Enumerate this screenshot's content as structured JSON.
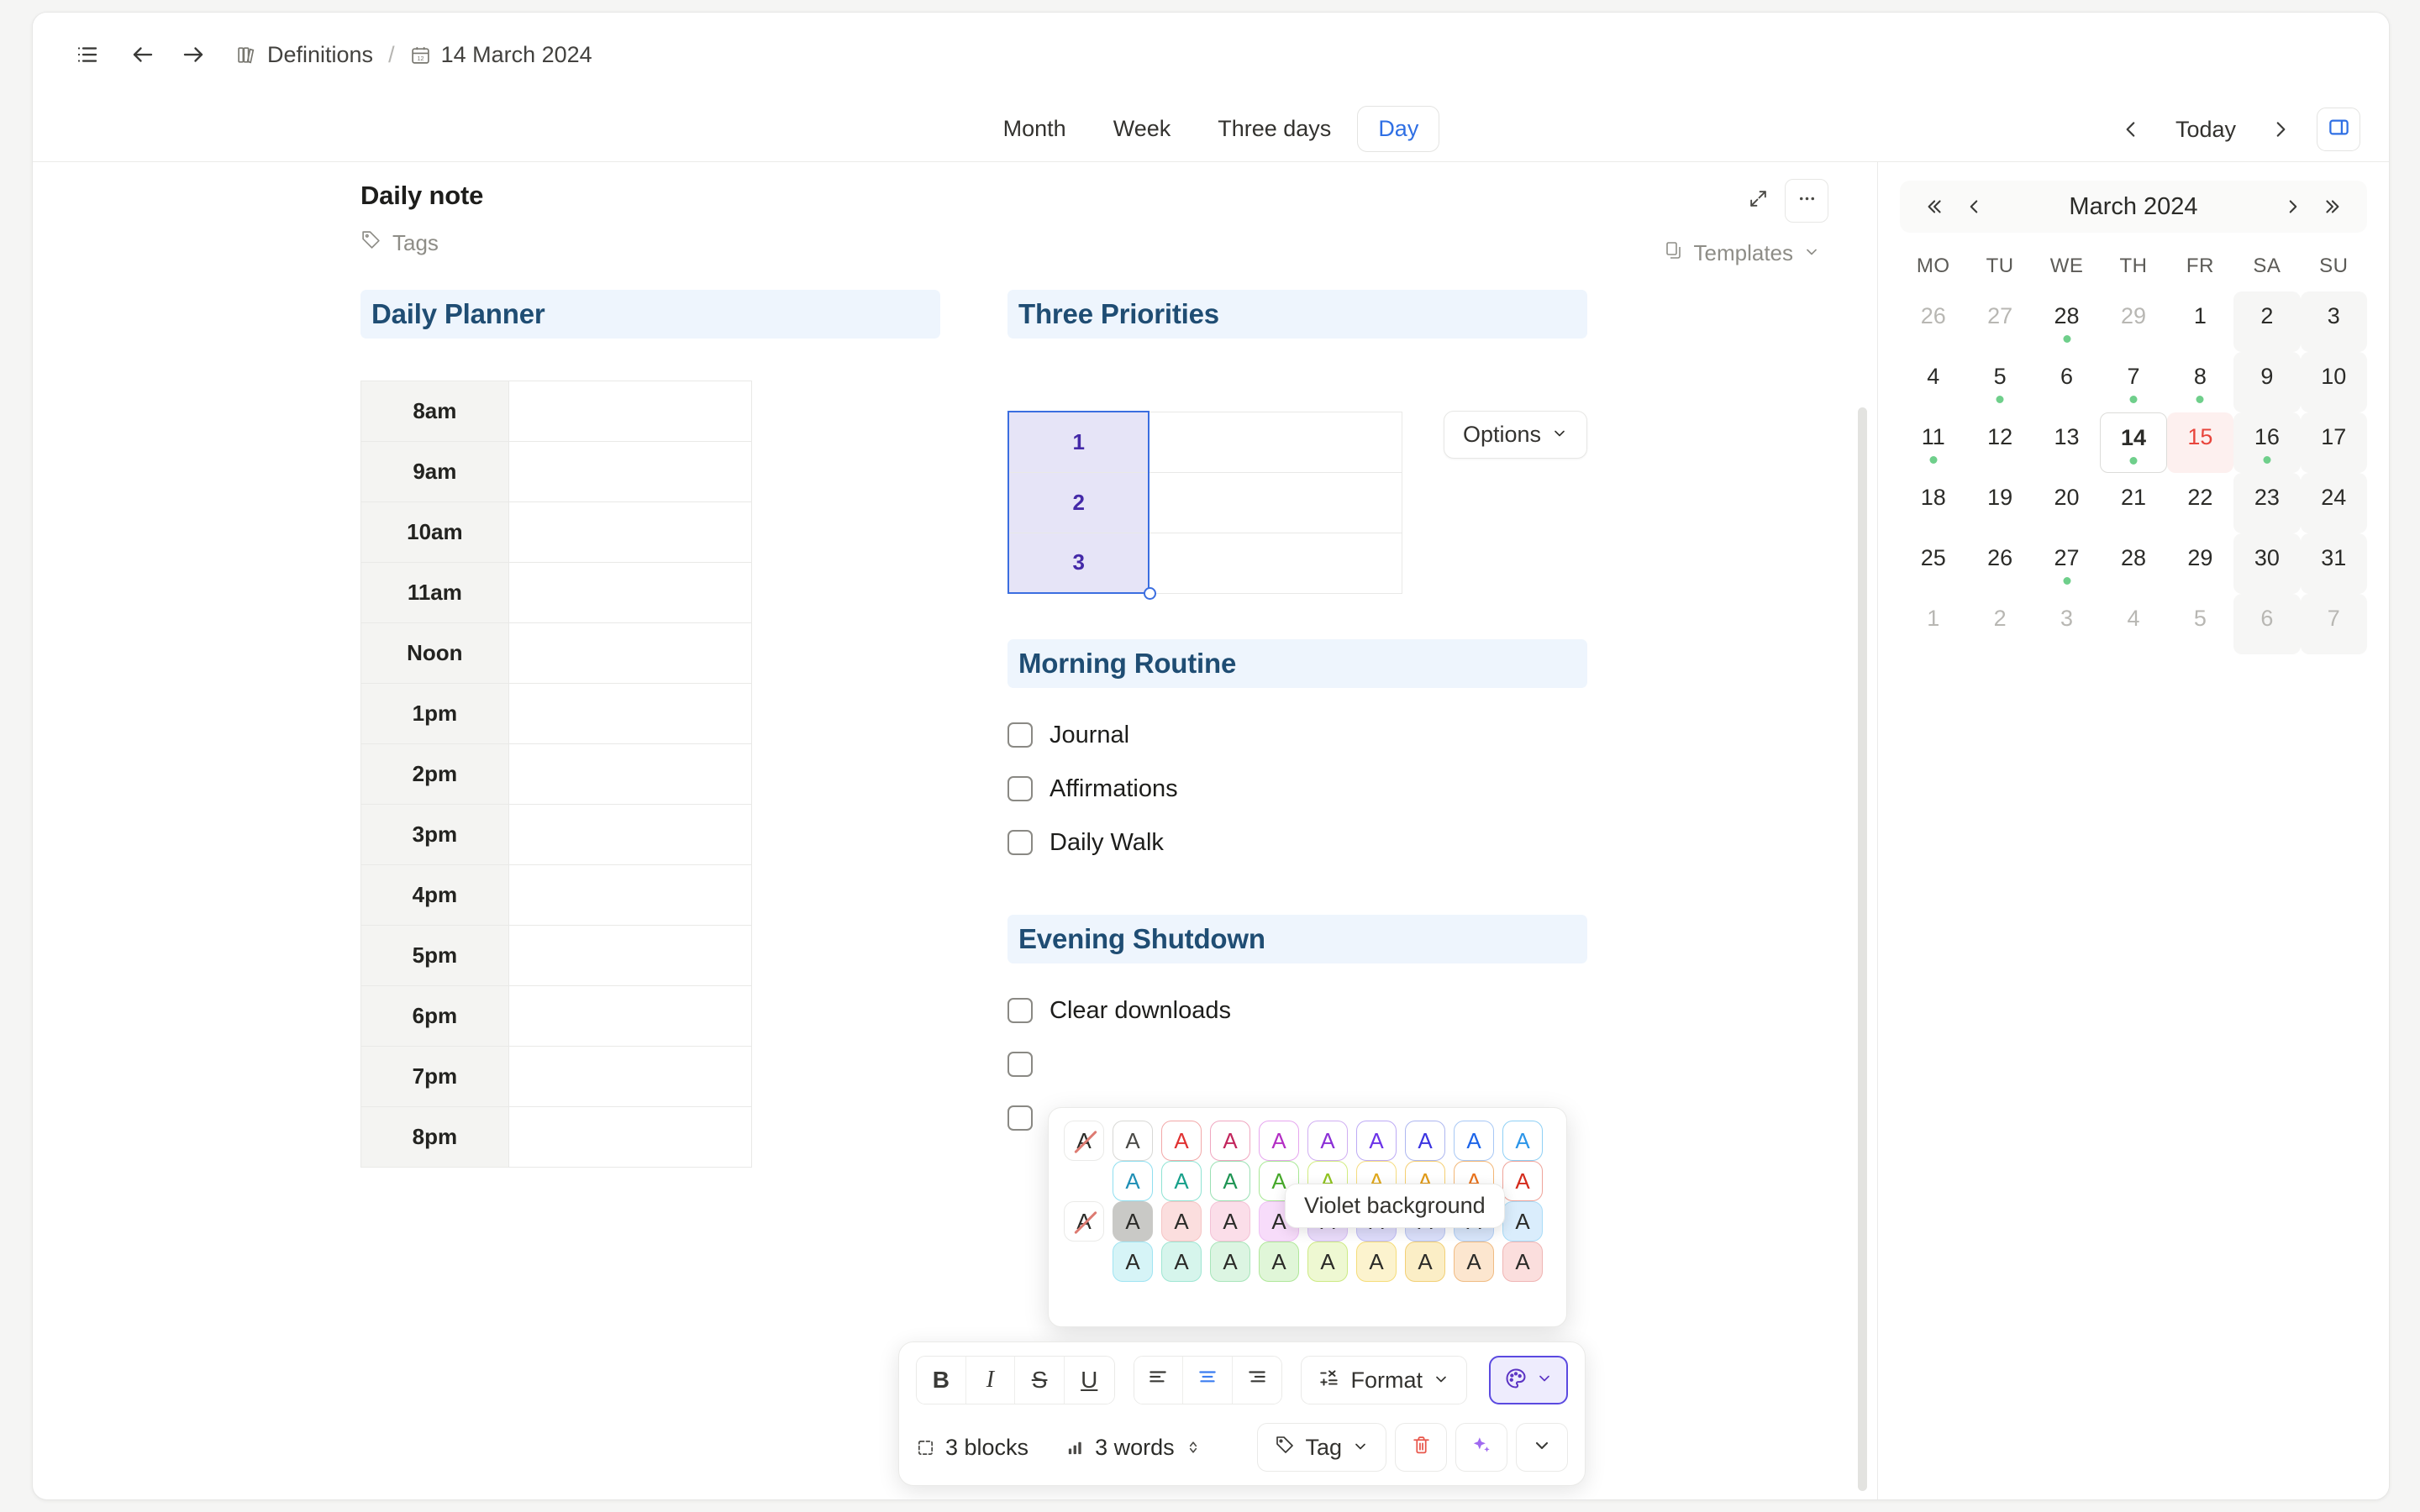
{
  "topbar": {
    "sidebar_toggle_icon": "list-icon",
    "back_icon": "arrow-left-icon",
    "forward_icon": "arrow-right-icon",
    "breadcrumb": {
      "parent_icon": "books-icon",
      "parent": "Definitions",
      "separator": "/",
      "current_icon": "calendar-icon",
      "current": "14 March 2024"
    }
  },
  "viewbar": {
    "tabs": [
      {
        "label": "Month",
        "active": false
      },
      {
        "label": "Week",
        "active": false
      },
      {
        "label": "Three days",
        "active": false
      },
      {
        "label": "Day",
        "active": true
      }
    ],
    "prev_icon": "chevron-left-icon",
    "today_label": "Today",
    "next_icon": "chevron-right-icon",
    "panel_toggle_icon": "right-panel-icon",
    "accent_color": "#2f6fe4"
  },
  "note": {
    "title": "Daily note",
    "expand_icon": "expand-icon",
    "more_icon": "ellipsis-icon",
    "tags_icon": "tag-icon",
    "tags_label": "Tags",
    "templates_icon": "template-icon",
    "templates_label": "Templates",
    "templates_chevron": "chevron-down-icon"
  },
  "planner": {
    "heading": "Daily Planner",
    "hours": [
      "8am",
      "9am",
      "10am",
      "11am",
      "Noon",
      "1pm",
      "2pm",
      "3pm",
      "4pm",
      "5pm",
      "6pm",
      "7pm",
      "8pm"
    ],
    "slots": [
      "",
      "",
      "",
      "",
      "",
      "",
      "",
      "",
      "",
      "",
      "",
      "",
      ""
    ]
  },
  "priorities": {
    "heading": "Three Priorities",
    "options_label": "Options",
    "options_chevron": "chevron-down-icon",
    "rows": [
      {
        "number": "1",
        "text": ""
      },
      {
        "number": "2",
        "text": ""
      },
      {
        "number": "3",
        "text": ""
      }
    ],
    "selection_border_color": "#3b6ee0",
    "selection_fill_color": "#e6e4f7",
    "number_text_color": "#4429a8"
  },
  "morning_routine": {
    "heading": "Morning Routine",
    "items": [
      {
        "label": "Journal",
        "checked": false
      },
      {
        "label": "Affirmations",
        "checked": false
      },
      {
        "label": "Daily Walk",
        "checked": false
      }
    ]
  },
  "evening_shutdown": {
    "heading": "Evening Shutdown",
    "items": [
      {
        "label": "Clear downloads",
        "checked": false
      },
      {
        "label": "",
        "checked": false
      },
      {
        "label": "",
        "checked": false
      }
    ]
  },
  "calendar": {
    "first_icon": "chevrons-left-icon",
    "prev_icon": "chevron-left-icon",
    "title": "March 2024",
    "next_icon": "chevron-right-icon",
    "last_icon": "chevrons-right-icon",
    "day_headers": [
      "MO",
      "TU",
      "WE",
      "TH",
      "FR",
      "SA",
      "SU"
    ],
    "dot_color": "#6fcf8b",
    "highlight_color": "#e8453c",
    "weeks": [
      [
        {
          "d": "26",
          "muted": true,
          "weekend": false,
          "dot": false,
          "today": false,
          "highlight": false
        },
        {
          "d": "27",
          "muted": true,
          "weekend": false,
          "dot": false,
          "today": false,
          "highlight": false
        },
        {
          "d": "28",
          "muted": false,
          "weekend": false,
          "dot": true,
          "today": false,
          "highlight": false
        },
        {
          "d": "29",
          "muted": true,
          "weekend": false,
          "dot": false,
          "today": false,
          "highlight": false
        },
        {
          "d": "1",
          "muted": false,
          "weekend": false,
          "dot": false,
          "today": false,
          "highlight": false
        },
        {
          "d": "2",
          "muted": false,
          "weekend": true,
          "dot": false,
          "today": false,
          "highlight": false
        },
        {
          "d": "3",
          "muted": false,
          "weekend": true,
          "dot": false,
          "today": false,
          "highlight": false
        }
      ],
      [
        {
          "d": "4",
          "muted": false,
          "weekend": false,
          "dot": false,
          "today": false,
          "highlight": false
        },
        {
          "d": "5",
          "muted": false,
          "weekend": false,
          "dot": true,
          "today": false,
          "highlight": false
        },
        {
          "d": "6",
          "muted": false,
          "weekend": false,
          "dot": false,
          "today": false,
          "highlight": false
        },
        {
          "d": "7",
          "muted": false,
          "weekend": false,
          "dot": true,
          "today": false,
          "highlight": false
        },
        {
          "d": "8",
          "muted": false,
          "weekend": false,
          "dot": true,
          "today": false,
          "highlight": false
        },
        {
          "d": "9",
          "muted": false,
          "weekend": true,
          "dot": false,
          "today": false,
          "highlight": false
        },
        {
          "d": "10",
          "muted": false,
          "weekend": true,
          "dot": false,
          "today": false,
          "highlight": false
        }
      ],
      [
        {
          "d": "11",
          "muted": false,
          "weekend": false,
          "dot": true,
          "today": false,
          "highlight": false
        },
        {
          "d": "12",
          "muted": false,
          "weekend": false,
          "dot": false,
          "today": false,
          "highlight": false
        },
        {
          "d": "13",
          "muted": false,
          "weekend": false,
          "dot": false,
          "today": false,
          "highlight": false
        },
        {
          "d": "14",
          "muted": false,
          "weekend": false,
          "dot": true,
          "today": true,
          "highlight": false
        },
        {
          "d": "15",
          "muted": false,
          "weekend": false,
          "dot": false,
          "today": false,
          "highlight": true
        },
        {
          "d": "16",
          "muted": false,
          "weekend": true,
          "dot": true,
          "today": false,
          "highlight": false
        },
        {
          "d": "17",
          "muted": false,
          "weekend": true,
          "dot": false,
          "today": false,
          "highlight": false
        }
      ],
      [
        {
          "d": "18",
          "muted": false,
          "weekend": false,
          "dot": false,
          "today": false,
          "highlight": false
        },
        {
          "d": "19",
          "muted": false,
          "weekend": false,
          "dot": false,
          "today": false,
          "highlight": false
        },
        {
          "d": "20",
          "muted": false,
          "weekend": false,
          "dot": false,
          "today": false,
          "highlight": false
        },
        {
          "d": "21",
          "muted": false,
          "weekend": false,
          "dot": false,
          "today": false,
          "highlight": false
        },
        {
          "d": "22",
          "muted": false,
          "weekend": false,
          "dot": false,
          "today": false,
          "highlight": false
        },
        {
          "d": "23",
          "muted": false,
          "weekend": true,
          "dot": false,
          "today": false,
          "highlight": false
        },
        {
          "d": "24",
          "muted": false,
          "weekend": true,
          "dot": false,
          "today": false,
          "highlight": false
        }
      ],
      [
        {
          "d": "25",
          "muted": false,
          "weekend": false,
          "dot": false,
          "today": false,
          "highlight": false
        },
        {
          "d": "26",
          "muted": false,
          "weekend": false,
          "dot": false,
          "today": false,
          "highlight": false
        },
        {
          "d": "27",
          "muted": false,
          "weekend": false,
          "dot": true,
          "today": false,
          "highlight": false
        },
        {
          "d": "28",
          "muted": false,
          "weekend": false,
          "dot": false,
          "today": false,
          "highlight": false
        },
        {
          "d": "29",
          "muted": false,
          "weekend": false,
          "dot": false,
          "today": false,
          "highlight": false
        },
        {
          "d": "30",
          "muted": false,
          "weekend": true,
          "dot": false,
          "today": false,
          "highlight": false
        },
        {
          "d": "31",
          "muted": false,
          "weekend": true,
          "dot": false,
          "today": false,
          "highlight": false
        }
      ],
      [
        {
          "d": "1",
          "muted": true,
          "weekend": false,
          "dot": false,
          "today": false,
          "highlight": false
        },
        {
          "d": "2",
          "muted": true,
          "weekend": false,
          "dot": false,
          "today": false,
          "highlight": false
        },
        {
          "d": "3",
          "muted": true,
          "weekend": false,
          "dot": false,
          "today": false,
          "highlight": false
        },
        {
          "d": "4",
          "muted": true,
          "weekend": false,
          "dot": false,
          "today": false,
          "highlight": false
        },
        {
          "d": "5",
          "muted": true,
          "weekend": false,
          "dot": false,
          "today": false,
          "highlight": false
        },
        {
          "d": "6",
          "muted": true,
          "weekend": true,
          "dot": false,
          "today": false,
          "highlight": false
        },
        {
          "d": "7",
          "muted": true,
          "weekend": true,
          "dot": false,
          "today": false,
          "highlight": false
        }
      ]
    ]
  },
  "color_popup": {
    "glyph": "A",
    "tooltip": "Violet background",
    "rows": [
      {
        "kind": "text-color",
        "indent": false,
        "swatches": [
          {
            "name": "no-color",
            "fg": "#2b2b28",
            "bg": "#ffffff",
            "border": "#eaeae8",
            "slash": true
          },
          {
            "name": "gray",
            "fg": "#4a4a47",
            "bg": "#ffffff",
            "border": "#d8d8d5",
            "slash": false
          },
          {
            "name": "red",
            "fg": "#e03131",
            "bg": "#ffffff",
            "border": "#f2a8a8",
            "slash": false
          },
          {
            "name": "pink",
            "fg": "#c2255c",
            "bg": "#ffffff",
            "border": "#f0a6c0",
            "slash": false
          },
          {
            "name": "magenta",
            "fg": "#b32ec4",
            "bg": "#ffffff",
            "border": "#e6a6ef",
            "slash": false
          },
          {
            "name": "purple",
            "fg": "#8b2fd6",
            "bg": "#ffffff",
            "border": "#d0aef2",
            "slash": false
          },
          {
            "name": "violet",
            "fg": "#6b32e8",
            "bg": "#ffffff",
            "border": "#bdaaf5",
            "slash": false
          },
          {
            "name": "indigo",
            "fg": "#3b34e0",
            "bg": "#ffffff",
            "border": "#adb6f0",
            "slash": false
          },
          {
            "name": "blue",
            "fg": "#1c64e8",
            "bg": "#ffffff",
            "border": "#a8c8f5",
            "slash": false
          },
          {
            "name": "light-blue",
            "fg": "#2b95e8",
            "bg": "#ffffff",
            "border": "#8fd0f5",
            "slash": false
          }
        ]
      },
      {
        "kind": "text-color",
        "indent": true,
        "swatches": [
          {
            "name": "cyan",
            "fg": "#1f8fb5",
            "bg": "#ffffff",
            "border": "#8fdff0",
            "slash": false
          },
          {
            "name": "teal",
            "fg": "#17a08a",
            "bg": "#ffffff",
            "border": "#8fe3d3",
            "slash": false
          },
          {
            "name": "green",
            "fg": "#1e9453",
            "bg": "#ffffff",
            "border": "#9ae0b3",
            "slash": false
          },
          {
            "name": "lime-green",
            "fg": "#46a82a",
            "bg": "#ffffff",
            "border": "#a8e895",
            "slash": false
          },
          {
            "name": "lime",
            "fg": "#8fc31f",
            "bg": "#ffffff",
            "border": "#d2ec80",
            "slash": false
          },
          {
            "name": "yellow",
            "fg": "#e0a81c",
            "bg": "#ffffff",
            "border": "#f5dc80",
            "slash": false
          },
          {
            "name": "amber",
            "fg": "#e09a18",
            "bg": "#ffffff",
            "border": "#f5cf72",
            "slash": false
          },
          {
            "name": "orange",
            "fg": "#e8721c",
            "bg": "#ffffff",
            "border": "#f3b777",
            "slash": false
          },
          {
            "name": "dark-red",
            "fg": "#d42b1c",
            "bg": "#ffffff",
            "border": "#efa39a",
            "slash": false
          }
        ]
      },
      {
        "kind": "background-color",
        "indent": false,
        "swatches": [
          {
            "name": "no-background",
            "fg": "#2b2b28",
            "bg": "#ffffff",
            "border": "#eaeae8",
            "slash": true
          },
          {
            "name": "gray-background",
            "fg": "#2b2b28",
            "bg": "#c9c9c6",
            "border": "#c9c9c6",
            "slash": false
          },
          {
            "name": "red-background",
            "fg": "#2b2b28",
            "bg": "#fbdede",
            "border": "#f5c4c4",
            "slash": false
          },
          {
            "name": "pink-background",
            "fg": "#2b2b28",
            "bg": "#fbdee9",
            "border": "#f3c2d6",
            "slash": false
          },
          {
            "name": "magenta-background",
            "fg": "#2b2b28",
            "bg": "#f7dcfa",
            "border": "#eec0f5",
            "slash": false
          },
          {
            "name": "purple-background",
            "fg": "#2b2b28",
            "bg": "#eadcfb",
            "border": "#d8c1f5",
            "slash": false
          },
          {
            "name": "violet-background",
            "fg": "#2b2b28",
            "bg": "#dedcfb",
            "border": "#c2bef5",
            "slash": false
          },
          {
            "name": "indigo-background",
            "fg": "#2b2b28",
            "bg": "#dbe0fb",
            "border": "#bac6f2",
            "slash": false
          },
          {
            "name": "blue-background",
            "fg": "#2b2b28",
            "bg": "#d8e6fb",
            "border": "#b4d0f5",
            "slash": false
          },
          {
            "name": "light-blue-background",
            "fg": "#2b2b28",
            "bg": "#daedfc",
            "border": "#a9dcf7",
            "slash": false
          }
        ]
      },
      {
        "kind": "background-color",
        "indent": true,
        "swatches": [
          {
            "name": "cyan-background",
            "fg": "#2b2b28",
            "bg": "#d6f4f7",
            "border": "#9fe4f2",
            "slash": false
          },
          {
            "name": "teal-background",
            "fg": "#2b2b28",
            "bg": "#d6f5ec",
            "border": "#9fe6d3",
            "slash": false
          },
          {
            "name": "green-background",
            "fg": "#2b2b28",
            "bg": "#dcf5e2",
            "border": "#a8e5ba",
            "slash": false
          },
          {
            "name": "lime-green-background",
            "fg": "#2b2b28",
            "bg": "#e0f6d8",
            "border": "#b0e79a",
            "slash": false
          },
          {
            "name": "lime-background",
            "fg": "#2b2b28",
            "bg": "#eef8d2",
            "border": "#cdea84",
            "slash": false
          },
          {
            "name": "yellow-background",
            "fg": "#2b2b28",
            "bg": "#fcf3ce",
            "border": "#f5dc79",
            "slash": false
          },
          {
            "name": "amber-background",
            "fg": "#2b2b28",
            "bg": "#fbeec6",
            "border": "#f2cf76",
            "slash": false
          },
          {
            "name": "orange-background",
            "fg": "#2b2b28",
            "bg": "#fce6cf",
            "border": "#f0bb83",
            "slash": false
          },
          {
            "name": "dark-red-background",
            "fg": "#2b2b28",
            "bg": "#fbdedd",
            "border": "#efb5b4",
            "slash": false
          }
        ]
      }
    ]
  },
  "toolbar": {
    "bold_label": "B",
    "italic_label": "I",
    "strike_label": "S",
    "underline_label": "U",
    "align_left_icon": "align-left-icon",
    "align_center_icon": "align-center-icon",
    "align_right_icon": "align-right-icon",
    "format_icon": "math-format-icon",
    "format_label": "Format",
    "format_chevron": "chevron-down-icon",
    "palette_icon": "palette-icon",
    "palette_chevron": "chevron-down-icon",
    "blocks_icon": "block-icon",
    "blocks_label": "3 blocks",
    "words_icon": "bar-chart-icon",
    "words_label": "3 words",
    "words_stepper_icon": "up-down-icon",
    "tag_icon": "tag-icon",
    "tag_label": "Tag",
    "tag_chevron": "chevron-down-icon",
    "delete_icon": "trash-icon",
    "ai_icon": "sparkle-icon",
    "more_icon": "chevron-down-icon",
    "active_align": "center",
    "palette_active_color": "#5b4ae0"
  }
}
